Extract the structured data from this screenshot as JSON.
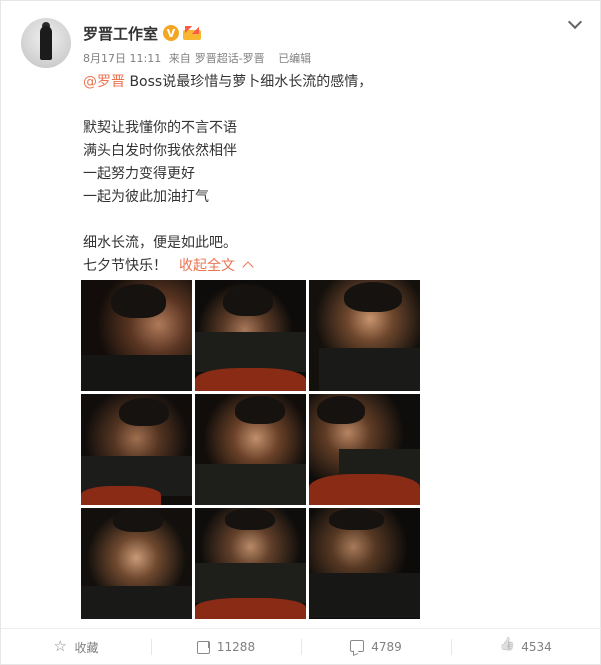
{
  "post": {
    "author": "罗晋工作室",
    "verified_badge": "V",
    "time": "8月17日 11:11",
    "source_prefix": "来自",
    "source": "罗晋超话-罗晋",
    "edited": "已编辑",
    "mention": "@罗晋",
    "lines": [
      " Boss说最珍惜与萝卜细水长流的感情，",
      "默契让我懂你的不言不语",
      "满头白发时你我依然相伴",
      "一起努力变得更好",
      "一起为彼此加油打气",
      "细水长流，便是如此吧。",
      "七夕节快乐！"
    ],
    "collapse_label": "收起全文",
    "photo_count": 9
  },
  "actions": {
    "favorite": "收藏",
    "repost": "11288",
    "comment": "4789",
    "like": "4534"
  },
  "colors": {
    "accent": "#eb7350",
    "badge": "#f4a623",
    "text": "#333333",
    "meta": "#808080"
  },
  "icons": {
    "favorite": "star-icon",
    "repost": "repost-icon",
    "comment": "comment-icon",
    "like": "thumbs-up-icon",
    "menu": "chevron-down-icon",
    "collapse": "chevron-up-icon"
  }
}
